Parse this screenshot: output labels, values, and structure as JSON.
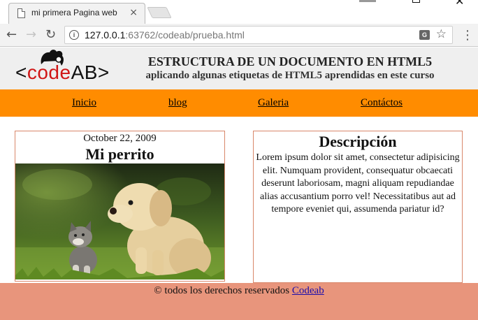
{
  "browser": {
    "tab_title": "mi primera Pagina web",
    "url_host": "127.0.0.1",
    "url_path": ":63762/codeab/prueba.html"
  },
  "header": {
    "logo": {
      "prefix": "<",
      "red": "code",
      "suffix": "AB>"
    },
    "title": "ESTRUCTURA DE UN DOCUMENTO EN HTML5",
    "subtitle": "aplicando algunas etiquetas de HTML5 aprendidas en este curso"
  },
  "nav": {
    "items": [
      {
        "label": "Inicio"
      },
      {
        "label": "blog"
      },
      {
        "label": "Galeria"
      },
      {
        "label": "Contáctos"
      }
    ]
  },
  "article": {
    "date": "October 22, 2009",
    "title": "Mi perrito"
  },
  "aside": {
    "title": "Descripción",
    "body": "Lorem ipsum dolor sit amet, consectetur adipisicing elit. Numquam provident, consequatur obcaecati deserunt laboriosam, magni aliquam repudiandae alias accusantium porro vel! Necessitatibus aut ad tempore eveniet qui, assumenda pariatur id?"
  },
  "footer": {
    "text": "© todos los derechos reservados",
    "link": "Codeab"
  },
  "colors": {
    "nav_bg": "#ff8c00",
    "footer_bg": "#e8957c",
    "border": "#d9876a",
    "logo_red": "#d01616"
  }
}
